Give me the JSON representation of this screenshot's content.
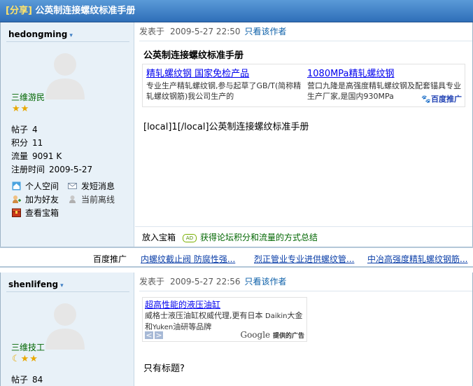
{
  "thread": {
    "tag": "[分享]",
    "title": "公英制连接螺纹标准手册"
  },
  "posts": [
    {
      "username": "hedongming",
      "dropdown": "▾",
      "rank": "三维游民",
      "stars": "★★",
      "stats": [
        {
          "label": "帖子",
          "value": "4"
        },
        {
          "label": "积分",
          "value": "11"
        },
        {
          "label": "流量",
          "value": "9091 K"
        },
        {
          "label": "注册时间",
          "value": "2009-5-27"
        }
      ],
      "actions": [
        "个人空间",
        "发短消息",
        "加为好友",
        "当前离线",
        "查看宝箱"
      ],
      "posted_label": "发表于",
      "posted_date": "2009-5-27 22:50",
      "only_author": "只看该作者",
      "post_title": "公英制连接螺纹标准手册",
      "ads": [
        {
          "title": "精轧螺纹钢 国家免检产品",
          "desc": "专业生产精轧螺纹钢,参与起草了GB/T(简称精轧螺纹钢筋)我公司生产的"
        },
        {
          "title": "1080MPa精轧螺纹钢",
          "desc": "营口九隆是高强度精轧螺纹钢及配套锚具专业生产厂家,是国内930MPa"
        }
      ],
      "baidu_label": "百度推广",
      "body": "[local]1[/local]公英制连接螺纹标准手册",
      "footer_label": "放入宝箱",
      "footer_ad_icon": "AD",
      "footer_link": "获得论坛积分和流量的方式总结"
    },
    {
      "username": "shenlifeng",
      "dropdown": "▾",
      "rank": "三维技工",
      "stars": "☾★★",
      "stats": [
        {
          "label": "帖子",
          "value": "84"
        }
      ],
      "posted_label": "发表于",
      "posted_date": "2009-5-27 22:56",
      "only_author": "只看该作者",
      "ad": {
        "title": "超高性能的液压油缸",
        "desc_a": "威格士液压油缸权威代理,更有日本 ",
        "desc_b": "Daikin",
        "desc_c": "大金和",
        "desc_d": "Yuken",
        "desc_e": "油研等品牌"
      },
      "google": "Google",
      "google_tag": "提供的广告",
      "body": "只有标题?"
    }
  ],
  "separator": {
    "label": "百度推广",
    "links": [
      "内螺纹截止阀 防腐性强...",
      "烈正管业专业进供螺纹管...",
      "中冶高强度精轧螺纹钢筋..."
    ]
  }
}
